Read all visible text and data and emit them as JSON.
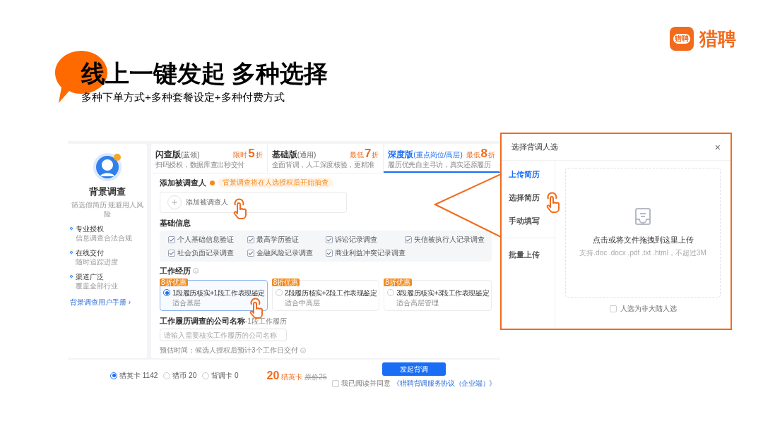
{
  "slide": {
    "title": "线上一键发起 多种选择",
    "subtitle": "多种下单方式+多种套餐设定+多种付费方式"
  },
  "logo": {
    "badge_text": "猎聘",
    "wordmark": "猎聘"
  },
  "sidebar": {
    "title": "背景调查",
    "slogan": "筛选假简历 规避用人风险",
    "features": [
      {
        "title": "专业授权",
        "desc": "信息调查合法合规"
      },
      {
        "title": "在线交付",
        "desc": "随时追踪进度"
      },
      {
        "title": "渠道广泛",
        "desc": "覆盖全部行业"
      }
    ],
    "manual_link": "背景调查用户手册 ›"
  },
  "tabs": [
    {
      "title": "闪查版",
      "tag": "(蓝领)",
      "desc": "扫码授权，数据库查出秒交付",
      "discount_label": "限时",
      "discount_value": "5",
      "discount_unit": "折",
      "selected": false
    },
    {
      "title": "基础版",
      "tag": "(通用)",
      "desc": "全面背调，人工深度核验，更精准",
      "discount_label": "最低",
      "discount_value": "7",
      "discount_unit": "折",
      "selected": false
    },
    {
      "title": "深度版",
      "tag": "(重点岗位/高层)",
      "desc": "履历优先自主寻访，真实还原履历",
      "discount_label": "最低",
      "discount_value": "8",
      "discount_unit": "折",
      "selected": true
    }
  ],
  "candidate": {
    "label": "添加被调查人",
    "notice": "背景调查将在人选授权后开始抽查",
    "add_label": "添加被调查人"
  },
  "basic_info": {
    "label": "基础信息",
    "items": [
      {
        "label": "个人基础信息验证",
        "checked": true
      },
      {
        "label": "最高学历验证",
        "checked": true
      },
      {
        "label": "诉讼记录调查",
        "checked": true
      },
      {
        "label": "失信被执行人记录调查",
        "checked": true
      },
      {
        "label": "社会负面记录调查",
        "checked": true
      },
      {
        "label": "金融风险记录调查",
        "checked": true
      },
      {
        "label": "商业利益冲突记录调查",
        "checked": true
      }
    ]
  },
  "work": {
    "label": "工作经历",
    "options": [
      {
        "badge": "8折优惠",
        "title": "1段履历核实+1段工作表现鉴定",
        "desc": "适合基层",
        "selected": true
      },
      {
        "badge": "8折优惠",
        "title": "2段履历核实+2段工作表现鉴定",
        "desc": "适合中高层",
        "selected": false
      },
      {
        "badge": "8折优惠",
        "title": "3段履历核实+3段工作表现鉴定",
        "desc": "适合高层管理",
        "selected": false
      }
    ]
  },
  "company": {
    "label": "工作履历调查的公司名称",
    "suffix": "-1段工作履历",
    "placeholder": "请输入需要核实工作履历的公司名称"
  },
  "estimate": "预估时间：候选人授权后预计3个工作日交付",
  "footer": {
    "payments": [
      {
        "label": "猎英卡 1142",
        "selected": true
      },
      {
        "label": "猎币 20",
        "selected": false
      },
      {
        "label": "背调卡 0",
        "selected": false
      }
    ],
    "price": "20",
    "price_unit": "猎英卡",
    "original_price": "原价25",
    "submit": "发起背调",
    "agree": {
      "text": "我已阅读并同意",
      "link": "《猎聘背调服务协议（企业端）》",
      "checked": false
    }
  },
  "dialog": {
    "title": "选择背调人选",
    "close": "×",
    "menu": [
      [
        {
          "label": "上传简历",
          "selected": true
        },
        {
          "label": "选择简历",
          "selected": false
        },
        {
          "label": "手动填写",
          "selected": false
        }
      ],
      [
        {
          "label": "批量上传",
          "selected": false
        }
      ]
    ],
    "upload": {
      "title": "点击或将文件拖拽到这里上传",
      "hint": "支持.doc .docx .pdf .txt .html，不超过3M"
    },
    "checkbox": {
      "label": "人选为非大陆人选",
      "checked": false
    }
  }
}
